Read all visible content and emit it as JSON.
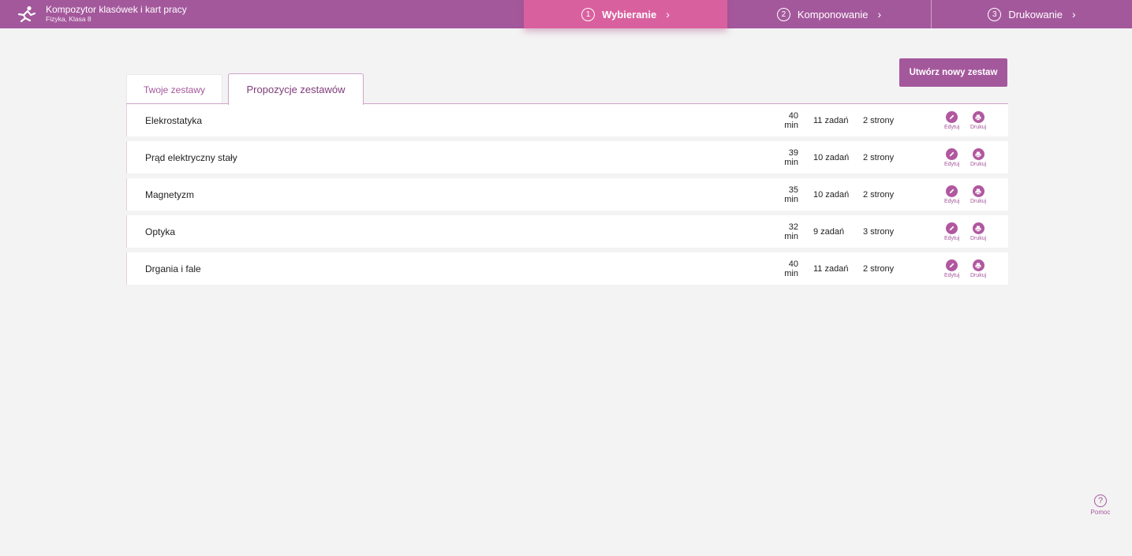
{
  "header": {
    "app_title": "Kompozytor klasówek i kart pracy",
    "subtitle": "Fizyka, Klasa  8",
    "logo_icon": "running-person-icon"
  },
  "steps": [
    {
      "number": "1",
      "label": "Wybieranie",
      "active": true
    },
    {
      "number": "2",
      "label": "Komponowanie",
      "active": false
    },
    {
      "number": "3",
      "label": "Drukowanie",
      "active": false
    }
  ],
  "create_button": "Utwórz nowy zestaw",
  "tabs": [
    {
      "label": "Twoje zestawy",
      "active": false
    },
    {
      "label": "Propozycje zestawów",
      "active": true
    }
  ],
  "sets": [
    {
      "name": "Elekrostatyka",
      "time": "40 min",
      "tasks": "11 zadań",
      "pages": "2 strony",
      "edit": "Edytuj",
      "print": "Drukuj"
    },
    {
      "name": "Prąd elektryczny stały",
      "time": "39 min",
      "tasks": "10 zadań",
      "pages": "2 strony",
      "edit": "Edytuj",
      "print": "Drukuj"
    },
    {
      "name": "Magnetyzm",
      "time": "35 min",
      "tasks": "10 zadań",
      "pages": "2 strony",
      "edit": "Edytuj",
      "print": "Drukuj"
    },
    {
      "name": "Optyka",
      "time": "32 min",
      "tasks": "9 zadań",
      "pages": "3 strony",
      "edit": "Edytuj",
      "print": "Drukuj"
    },
    {
      "name": "Drgania i fale",
      "time": "40 min",
      "tasks": "11 zadań",
      "pages": "2 strony",
      "edit": "Edytuj",
      "print": "Drukuj"
    }
  ],
  "help": {
    "symbol": "?",
    "label": "Pomoc"
  },
  "colors": {
    "accent": "#a4589c",
    "active_step": "#d9609f",
    "background": "#f3f3f3"
  }
}
